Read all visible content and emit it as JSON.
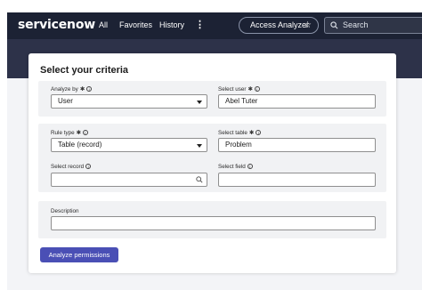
{
  "header": {
    "logo_text": "servicenow",
    "nav": {
      "all": "All",
      "favorites": "Favorites",
      "history": "History",
      "more": "⋮"
    },
    "app_pill": {
      "label": "Access Analyzer",
      "star": "☆"
    },
    "search": {
      "placeholder": "Search"
    }
  },
  "card": {
    "title": "Select your criteria",
    "analyze_by": {
      "label": "Analyze by",
      "value": "User"
    },
    "select_user": {
      "label": "Select user",
      "value": "Abel Tuter"
    },
    "rule_type": {
      "label": "Rule type",
      "value": "Table (record)"
    },
    "select_table": {
      "label": "Select table",
      "value": "Problem"
    },
    "select_record": {
      "label": "Select record",
      "value": ""
    },
    "select_field": {
      "label": "Select field",
      "value": ""
    },
    "description": {
      "label": "Description",
      "value": ""
    },
    "required_marker": "✱",
    "info_marker": "i",
    "submit_label": "Analyze permissions"
  },
  "colors": {
    "topbar": "#1c2234",
    "banner": "#2d3249",
    "section_bg": "#f1f2f4",
    "primary_button": "#4a4fb5",
    "logo_accent": "#62d84e"
  }
}
